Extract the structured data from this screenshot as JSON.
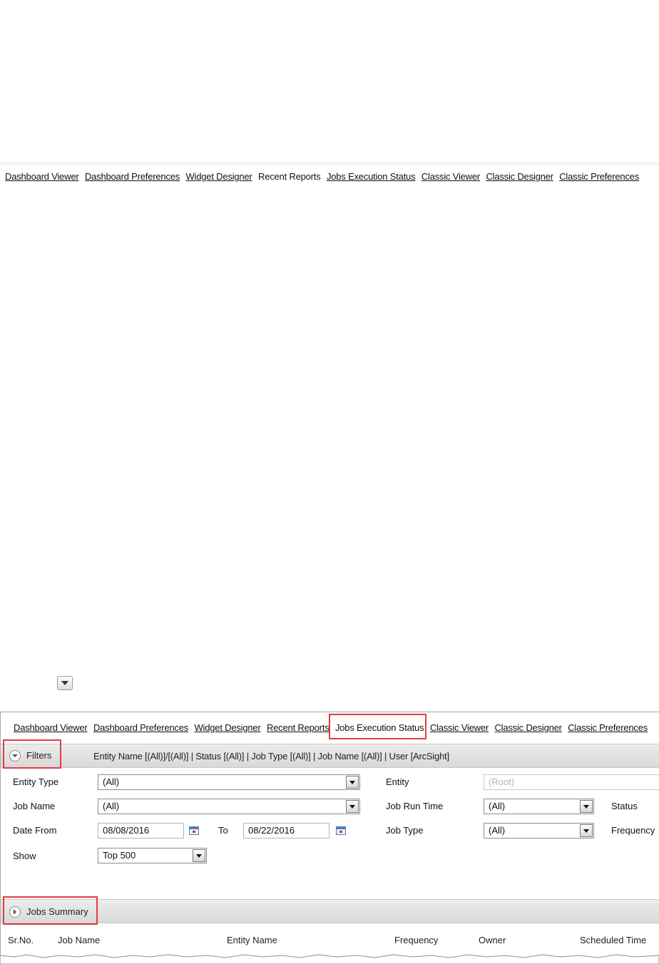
{
  "nav": [
    {
      "label": "Dashboard Viewer",
      "link": true
    },
    {
      "label": "Dashboard Preferences",
      "link": true
    },
    {
      "label": "Widget Designer",
      "link": true
    },
    {
      "label": "Recent Reports",
      "link": false
    },
    {
      "label": "Jobs Execution Status",
      "link": true
    },
    {
      "label": "Classic Viewer",
      "link": true
    },
    {
      "label": "Classic Designer",
      "link": true
    },
    {
      "label": "Classic Preferences",
      "link": true
    }
  ],
  "nav_panel": [
    {
      "label": "Dashboard Viewer",
      "link": true
    },
    {
      "label": "Dashboard Preferences",
      "link": true
    },
    {
      "label": "Widget Designer",
      "link": true
    },
    {
      "label": "Recent Reports",
      "link": true
    },
    {
      "label": "Jobs Execution Status",
      "link": false
    },
    {
      "label": "Classic Viewer",
      "link": true
    },
    {
      "label": "Classic Designer",
      "link": true
    },
    {
      "label": "Classic Preferences",
      "link": true
    }
  ],
  "filters": {
    "title": "Filters",
    "summary": "Entity Name [(All)]/[(All)] |  Status [(All)] |  Job Type [(All)] |  Job Name [(All)]  | User [ArcSight]",
    "entity_type_label": "Entity Type",
    "entity_type_value": "(All)",
    "entity_label": "Entity",
    "entity_value": "(Root)",
    "job_name_label": "Job Name",
    "job_name_value": "(All)",
    "job_run_time_label": "Job Run Time",
    "job_run_time_value": "(All)",
    "status_label": "Status",
    "date_from_label": "Date From",
    "date_from_value": "08/08/2016",
    "to_label": "To",
    "date_to_value": "08/22/2016",
    "job_type_label": "Job Type",
    "job_type_value": "(All)",
    "frequency_label": "Frequency",
    "show_label": "Show",
    "show_value": "Top 500"
  },
  "summary": {
    "title": "Jobs Summary",
    "columns": [
      "Sr.No.",
      "Job Name",
      "Entity Name",
      "Frequency",
      "Owner",
      "Scheduled Time"
    ]
  },
  "colors": {
    "highlight": "#e33b40",
    "section_bar": "#e0e0e0"
  }
}
